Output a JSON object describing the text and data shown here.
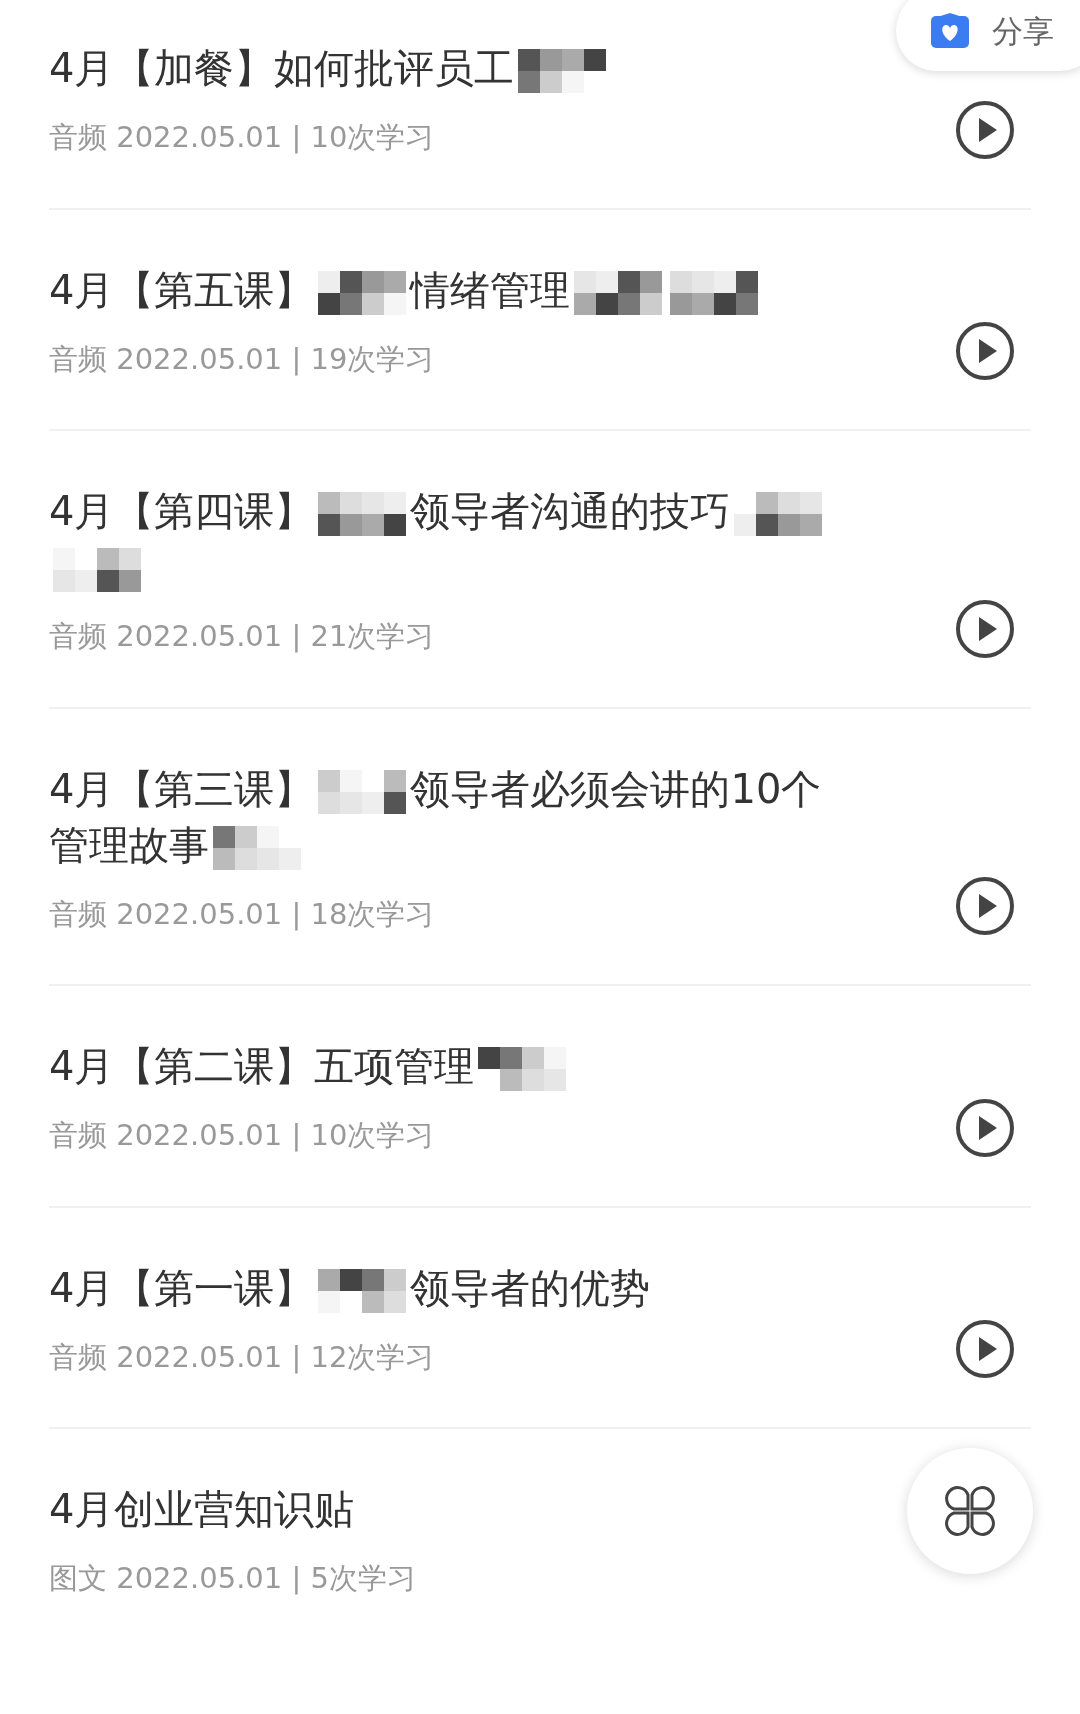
{
  "share_button": {
    "label": "分享"
  },
  "lessons": [
    {
      "kind": "audio",
      "title": [
        {
          "kind": "text",
          "text": "4月【加餐】如何批评员工"
        },
        {
          "kind": "mosaic"
        }
      ],
      "meta": "音频 2022.05.01 | 10次学习"
    },
    {
      "kind": "audio",
      "title": [
        {
          "kind": "text",
          "text": "4月【第五课】"
        },
        {
          "kind": "mosaic"
        },
        {
          "kind": "text",
          "text": "情绪管理"
        },
        {
          "kind": "mosaic"
        },
        {
          "kind": "mosaic"
        }
      ],
      "meta": "音频 2022.05.01 | 19次学习"
    },
    {
      "kind": "audio",
      "title": [
        {
          "kind": "text",
          "text": "4月【第四课】"
        },
        {
          "kind": "mosaic"
        },
        {
          "kind": "text",
          "text": "领导者沟通的技巧"
        },
        {
          "kind": "mosaic"
        },
        {
          "kind": "mosaic"
        }
      ],
      "meta": "音频 2022.05.01 | 21次学习"
    },
    {
      "kind": "audio",
      "title": [
        {
          "kind": "text",
          "text": "4月【第三课】"
        },
        {
          "kind": "mosaic"
        },
        {
          "kind": "text",
          "text": "领导者必须会讲的10个"
        },
        {
          "kind": "text",
          "text": "管理故事"
        },
        {
          "kind": "mosaic"
        }
      ],
      "meta": "音频 2022.05.01 | 18次学习"
    },
    {
      "kind": "audio",
      "title": [
        {
          "kind": "text",
          "text": "4月【第二课】五项管理"
        },
        {
          "kind": "mosaic"
        }
      ],
      "meta": "音频 2022.05.01 | 10次学习"
    },
    {
      "kind": "audio",
      "title": [
        {
          "kind": "text",
          "text": "4月【第一课】"
        },
        {
          "kind": "mosaic"
        },
        {
          "kind": "text",
          "text": "领导者的优势"
        }
      ],
      "meta": "音频 2022.05.01 | 12次学习"
    },
    {
      "kind": "article",
      "title": [
        {
          "kind": "text",
          "text": "4月创业营知识贴"
        }
      ],
      "meta": "图文 2022.05.01 | 5次学习"
    }
  ]
}
